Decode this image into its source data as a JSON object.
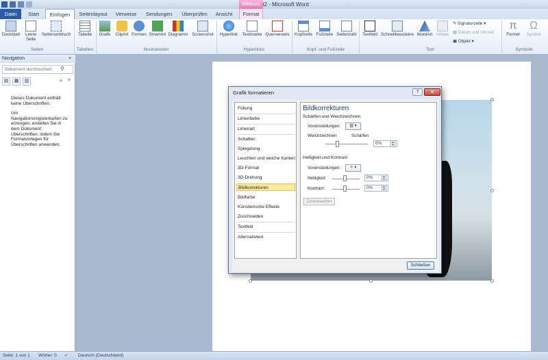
{
  "window": {
    "title": "Dokument2 - Microsoft Word",
    "context_tab": "Bildtools"
  },
  "tabs": [
    "Datei",
    "Start",
    "Einfügen",
    "Seitenlayout",
    "Verweise",
    "Sendungen",
    "Überprüfen",
    "Ansicht",
    "Format"
  ],
  "ribbon": {
    "buttons": {
      "deckblatt": "Deckblatt",
      "leere_seite": "Leere Seite",
      "seitenumbruch": "Seitenumbruch",
      "tabelle": "Tabelle",
      "grafik": "Grafik",
      "clipart": "ClipArt",
      "formen": "Formen",
      "smartart": "SmartArt",
      "diagramm": "Diagramm",
      "screenshot": "Screenshot",
      "hyperlink": "Hyperlink",
      "textmarke": "Textmarke",
      "querverweis": "Querverweis",
      "kopfzeile": "Kopfzeile",
      "fusszeile": "Fußzeile",
      "seitenzahl": "Seitenzahl",
      "textfeld": "Textfeld",
      "schnellbausteine": "Schnellbausteine",
      "wordart": "WordArt",
      "initiale": "Initiale",
      "signaturzeile": "Signaturzeile",
      "datum": "Datum und Uhrzeit",
      "objekt": "Objekt",
      "formel": "Formel",
      "symbol": "Symbol"
    },
    "groups": {
      "seiten": "Seiten",
      "tabellen": "Tabellen",
      "illustrationen": "Illustrationen",
      "hyperlinks": "Hyperlinks",
      "kopf_fuss": "Kopf- und Fußzeile",
      "text": "Text",
      "symbole": "Symbole"
    }
  },
  "nav": {
    "title": "Navigation",
    "close": "×",
    "search_placeholder": "Dokument durchsuchen",
    "message": "Dieses Dokument enthält keine Überschriften.",
    "hint": "Um Navigationsregisterkarten zu erzeugen, erstellen Sie in dem Dokument Überschriften, indem Sie Formatvorlagen für Überschriften anwenden."
  },
  "dialog": {
    "title": "Grafik formatieren",
    "help": "?",
    "close": "✕",
    "categories": [
      "Füllung",
      "Linienfarbe",
      "Linienart",
      "Schatten",
      "Spiegelung",
      "Leuchten und weiche Kanten",
      "3D-Format",
      "3D-Drehung",
      "Bildkorrekturen",
      "Bildfarbe",
      "Künstlerische Effekte",
      "Zuschneiden",
      "Textfeld",
      "Alternativtext"
    ],
    "selected": "Bildkorrekturen",
    "section_title": "Bildkorrekturen",
    "sharpen_heading": "Schärfen und Weichzeichnen",
    "presets_label": "Voreinstellungen:",
    "soften": "Weichzeichnen",
    "sharpen": "Schärfen",
    "sharpness_value": "0%",
    "brightness_heading": "Helligkeit und Kontrast",
    "brightness_label": "Helligkeit:",
    "brightness_value": "0%",
    "contrast_label": "Kontrast:",
    "contrast_value": "0%",
    "reset": "Zurücksetzen",
    "close_button": "Schließen"
  },
  "status": {
    "page": "Seite: 1 von 1",
    "words": "Wörter: 0",
    "language": "Deutsch (Deutschland)"
  }
}
